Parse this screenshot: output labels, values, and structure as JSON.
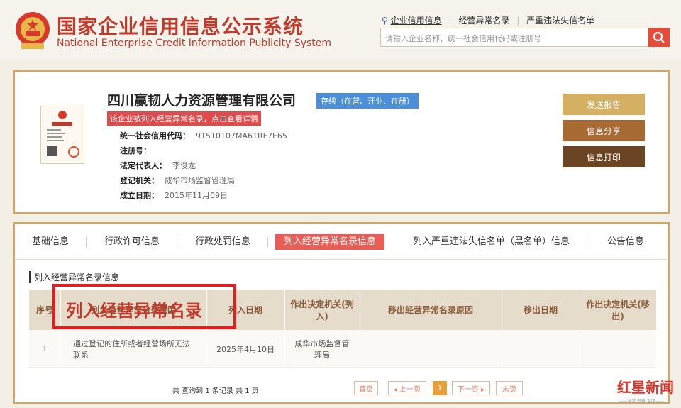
{
  "header": {
    "title_cn": "国家企业信用信息公示系统",
    "title_en": "National Enterprise Credit Information Publicity System",
    "links": [
      "企业信用信息",
      "经营异常名录",
      "严重违法失信名单"
    ],
    "search_placeholder": "请输入企业名称、统一社会信用代码或注册号"
  },
  "company": {
    "name": "四川赢韧人力资源管理有限公司",
    "status": "存续（在营、开业、在册）",
    "abnormal_notice": "该企业被列入经营异常名录，点击查看详情",
    "fields": [
      {
        "label": "统一社会信用代码：",
        "value": "91510107MA61RF7E65"
      },
      {
        "label": "注册号：",
        "value": ""
      },
      {
        "label": "法定代表人：",
        "value": "李俊龙"
      },
      {
        "label": "登记机关：",
        "value": "成华市场监督管理局"
      },
      {
        "label": "成立日期：",
        "value": "2015年11月09日"
      }
    ],
    "buttons": [
      "发送报告",
      "信息分享",
      "信息打印"
    ]
  },
  "tabs": [
    "基础信息",
    "行政许可信息",
    "行政处罚信息",
    "列入经营异常名录信息",
    "列入严重违法失信名单（黑名单）信息",
    "公告信息"
  ],
  "section": {
    "title": "列入经营异常名录信息",
    "overlay": "列入经营异常名录",
    "headers": [
      "序号",
      "列入经营异常名录原因",
      "列入日期",
      "作出决定机关(列入)",
      "移出经营异常名录原因",
      "移出日期",
      "作出决定机关(移出)"
    ],
    "rows": [
      [
        "1",
        "通过登记的住所或者经营场所无法联系",
        "2025年4月10日",
        "成华市场监督管理局",
        "",
        "",
        ""
      ]
    ],
    "count_text": "共 查询到 1 条记录 共 1 页",
    "pagination": [
      "首页",
      "◂ 上一页",
      "1",
      "下一页 ▸",
      "末页"
    ]
  },
  "watermark": {
    "text": "红星新闻",
    "sub": "——深度·思辨·温度——"
  },
  "colors": {
    "brand_red": "#c0392b",
    "gold": "#c9a96e",
    "tab_active": "#e85d55",
    "status_blue": "#4a8fd8"
  }
}
